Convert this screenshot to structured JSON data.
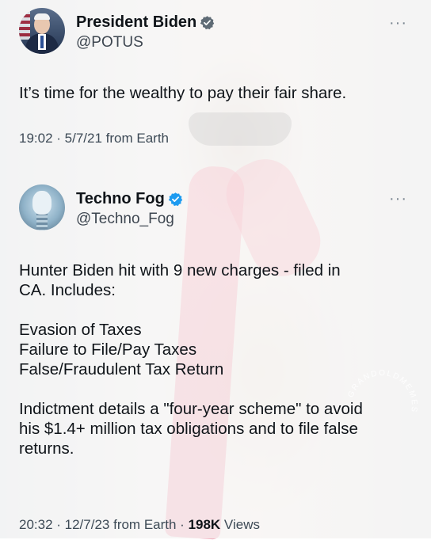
{
  "tweets": [
    {
      "name": "President Biden",
      "handle": "@POTUS",
      "text": [
        "It’s time for the wealthy to pay their fair share."
      ],
      "time": "19:02 · 5/7/21 from Earth",
      "avatar_icon": "biden-avatar"
    },
    {
      "name": "Techno Fog",
      "handle": "@Techno_Fog",
      "text": [
        "Hunter Biden hit with 9 new charges - filed in",
        "CA. Includes:",
        "",
        "Evasion of Taxes",
        "Failure to File/Pay Taxes",
        "False/Fraudulent Tax Return",
        "",
        "Indictment details a \"four-year scheme\" to avoid",
        "his $1.4+ million tax obligations and to file false",
        "returns."
      ],
      "time": "20:32 · 12/7/23 from Earth · ",
      "views_count": "198K",
      "views_label": " Views",
      "avatar_icon": "robot-avatar"
    }
  ],
  "more_glyph": "···",
  "watermark_text": "GRANDOLDMEMES",
  "colors": {
    "verified": "#1d9bf0",
    "text": "#0f1419",
    "secondary": "#3d4a56"
  }
}
